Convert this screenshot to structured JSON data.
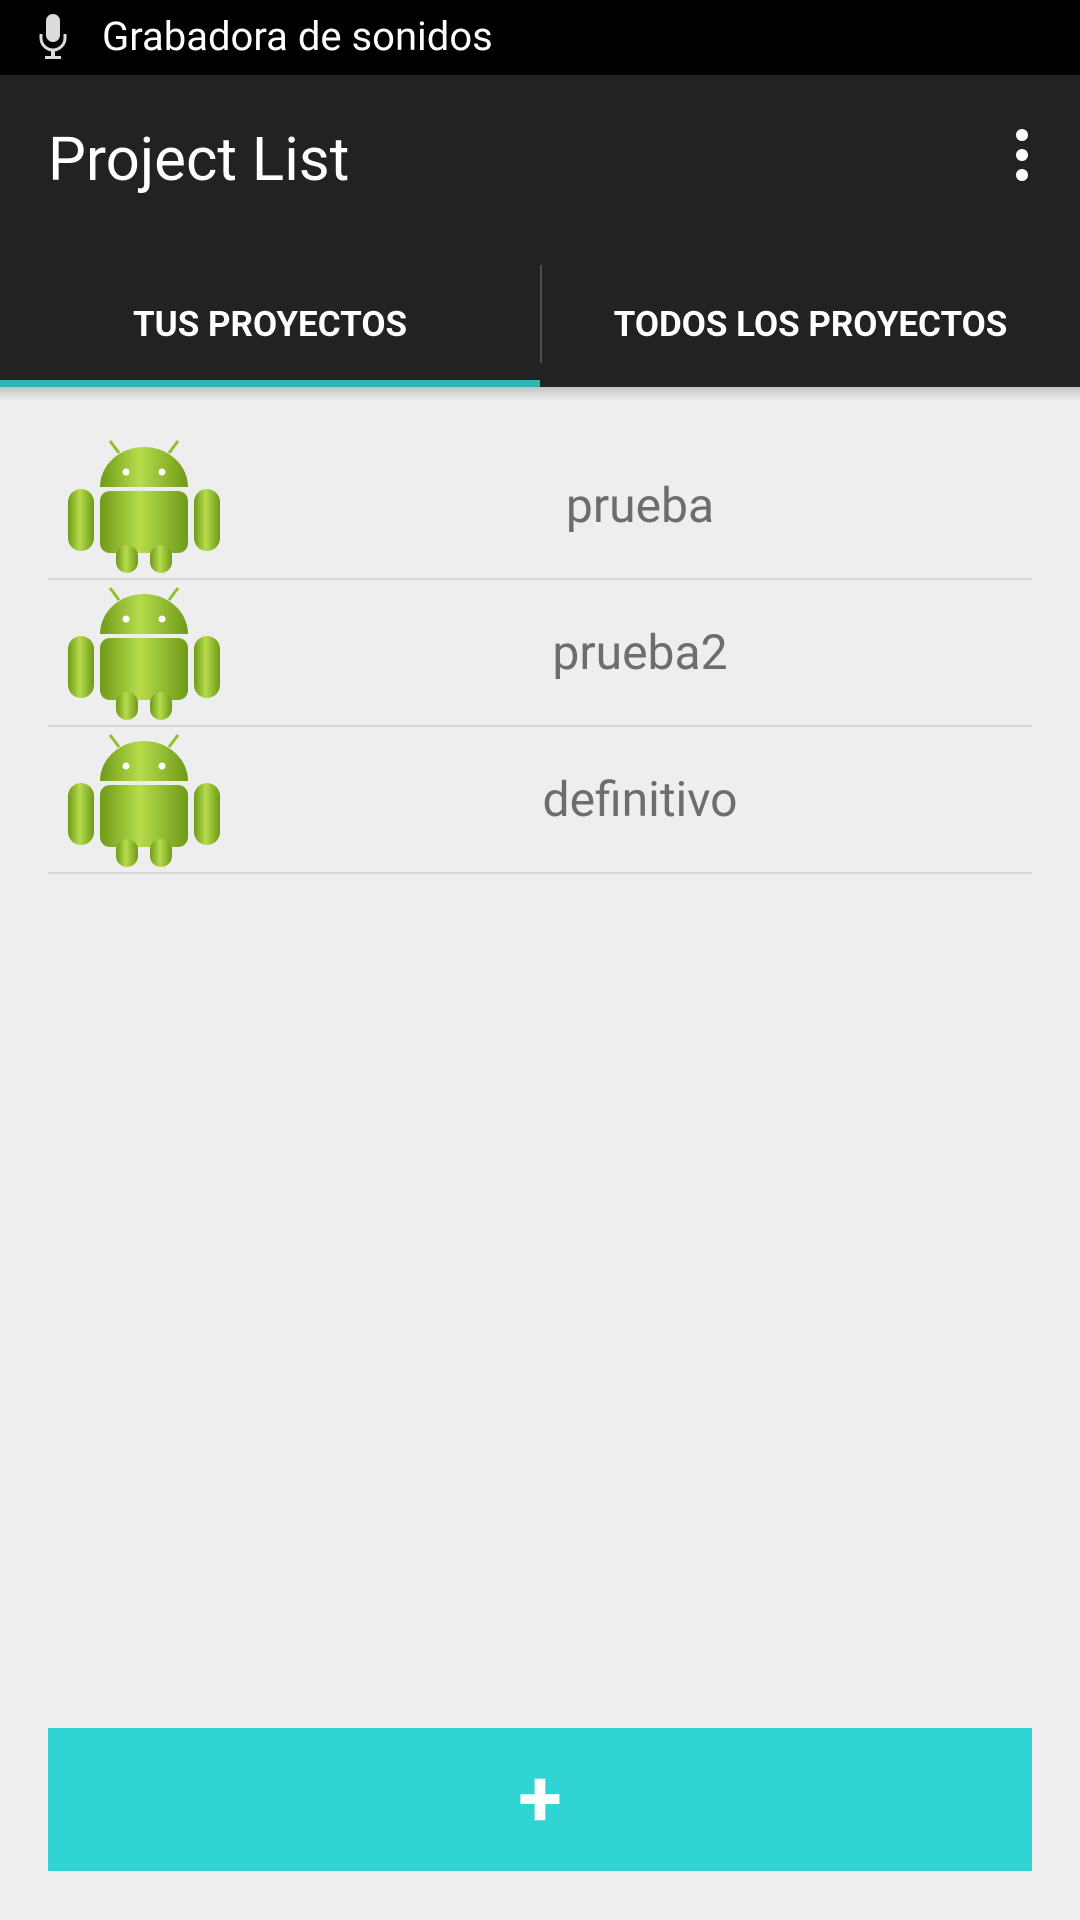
{
  "status_bar": {
    "notification_text": "Grabadora de sonidos",
    "icon": "microphone-icon"
  },
  "action_bar": {
    "title": "Project List",
    "overflow_icon": "overflow-menu-icon"
  },
  "tabs": [
    {
      "label": "TUS PROYECTOS",
      "selected": true
    },
    {
      "label": "TODOS LOS PROYECTOS",
      "selected": false
    }
  ],
  "projects": [
    {
      "name": "prueba",
      "icon": "android-icon"
    },
    {
      "name": "prueba2",
      "icon": "android-icon"
    },
    {
      "name": "definitivo",
      "icon": "android-icon"
    }
  ],
  "add_button": {
    "label": "+"
  },
  "colors": {
    "accent": "#33b5b5",
    "add_button": "#31d4d4",
    "action_bar": "#222222",
    "background": "#eeeeee",
    "android_green": "#8fbf2a"
  }
}
